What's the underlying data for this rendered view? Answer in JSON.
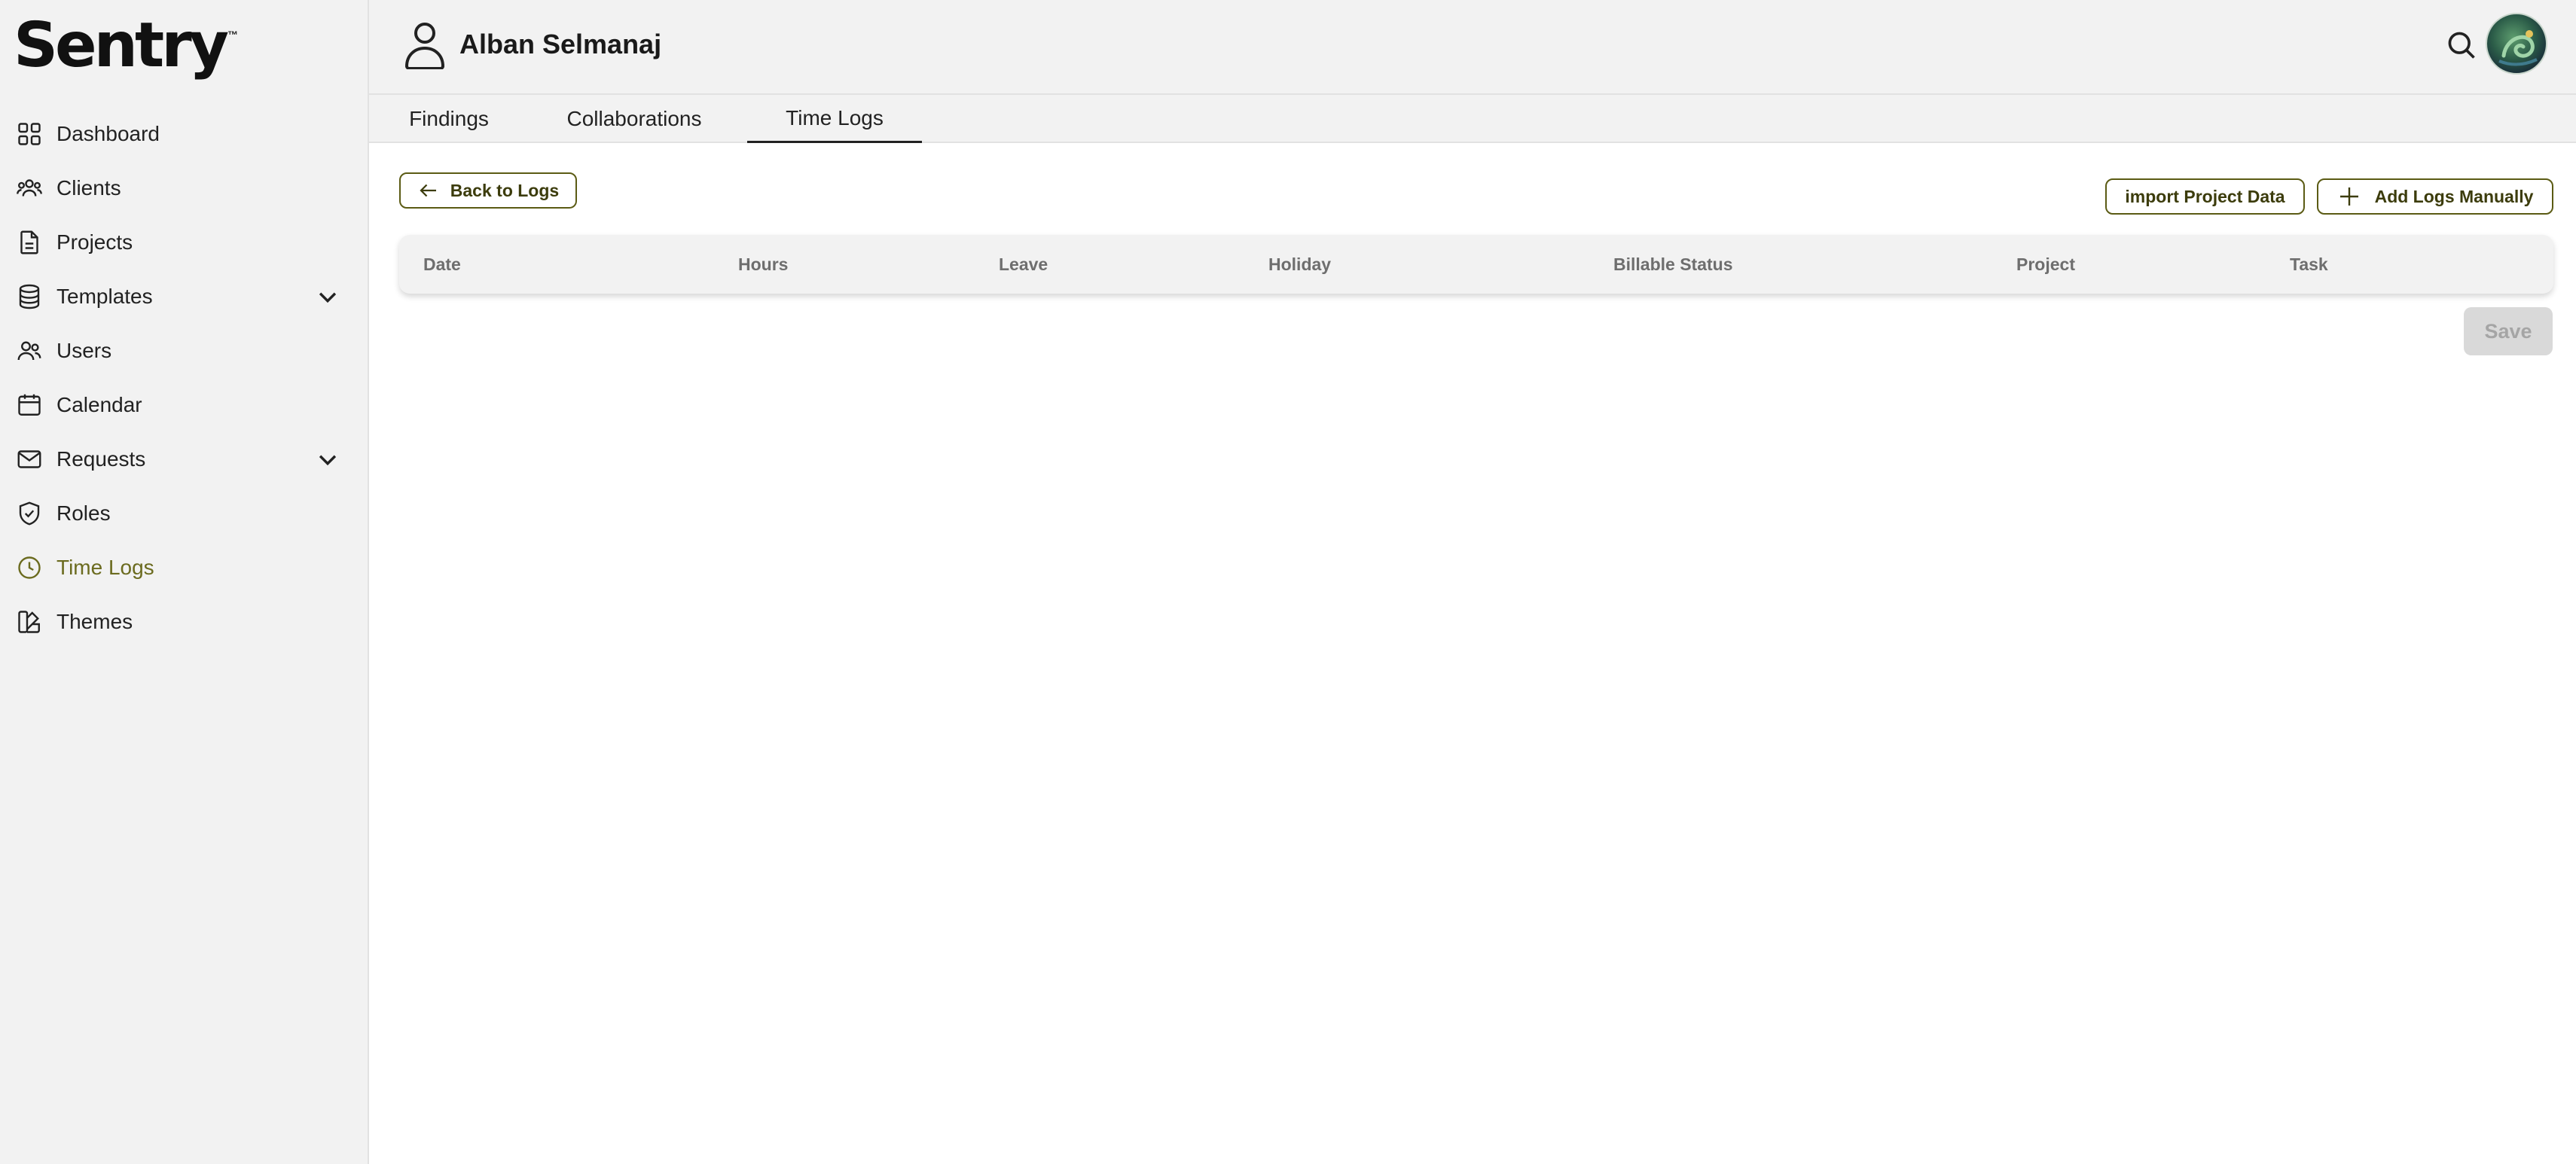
{
  "app": {
    "logo_text": "Sentry",
    "logo_tm": "™"
  },
  "sidebar": {
    "items": [
      {
        "label": "Dashboard",
        "icon": "grid-icon"
      },
      {
        "label": "Clients",
        "icon": "users-group-icon"
      },
      {
        "label": "Projects",
        "icon": "document-icon"
      },
      {
        "label": "Templates",
        "icon": "database-icon",
        "has_submenu": true
      },
      {
        "label": "Users",
        "icon": "users-icon"
      },
      {
        "label": "Calendar",
        "icon": "calendar-icon"
      },
      {
        "label": "Requests",
        "icon": "mail-icon",
        "has_submenu": true
      },
      {
        "label": "Roles",
        "icon": "shield-check-icon"
      },
      {
        "label": "Time Logs",
        "icon": "clock-icon",
        "active": true
      },
      {
        "label": "Themes",
        "icon": "palette-icon"
      }
    ]
  },
  "header": {
    "user_name": "Alban Selmanaj"
  },
  "tabs": [
    {
      "label": "Findings"
    },
    {
      "label": "Collaborations"
    },
    {
      "label": "Time Logs",
      "active": true
    }
  ],
  "actions": {
    "back_label": "Back to Logs",
    "import_label": "import Project Data",
    "add_label": "Add Logs Manually",
    "save_label": "Save"
  },
  "table": {
    "columns": [
      "Date",
      "Hours",
      "Leave",
      "Holiday",
      "Billable Status",
      "Project",
      "Task"
    ]
  },
  "colors": {
    "accent": "#5b5b14",
    "active_nav": "#6b6b1f",
    "sidebar_bg": "#f2f2f2",
    "disabled_bg": "#d9d9d9"
  }
}
